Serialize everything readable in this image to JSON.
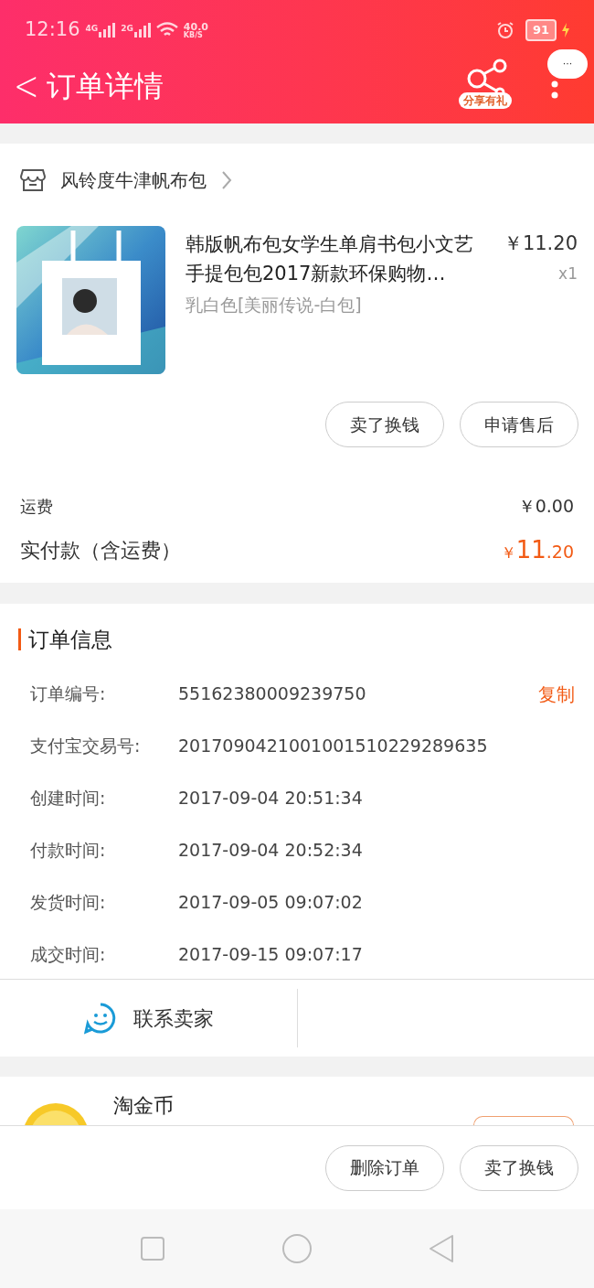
{
  "status_bar": {
    "time": "12:16",
    "net_1": "4G",
    "net_2": "2G",
    "speed": "40.0",
    "speed_unit": "KB/S",
    "battery": "91"
  },
  "header": {
    "back": "<",
    "title": "订单详情",
    "share_badge": "分享有礼",
    "more_bubble": "···"
  },
  "shop": {
    "name": "风铃度牛津帆布包"
  },
  "product": {
    "kind": "picture",
    "title": "韩版帆布包女学生单肩书包小文艺手提包包2017新款环保购物…",
    "price": "￥11.20",
    "quantity": "x1",
    "variant": "乳白色[美丽传说-白包]"
  },
  "product_actions": [
    "卖了换钱",
    "申请售后"
  ],
  "costs": [
    {
      "label": "运费",
      "value": "￥0.00",
      "kind": "plain"
    },
    {
      "label": "实付款（含运费）",
      "currency": "￥",
      "value": "11",
      "decimals": ".20",
      "kind": "total"
    }
  ],
  "order_info": {
    "title": "订单信息",
    "copy": "复制",
    "rows": [
      {
        "label": "订单编号:",
        "value": "55162380009239750"
      },
      {
        "label": "支付宝交易号:",
        "value": "2017090421001001510229289635"
      },
      {
        "label": "创建时间:",
        "value": "2017-09-04 20:51:34"
      },
      {
        "label": "付款时间:",
        "value": "2017-09-04 20:52:34"
      },
      {
        "label": "发货时间:",
        "value": "2017-09-05 09:07:02"
      },
      {
        "label": "成交时间:",
        "value": "2017-09-15 09:07:17"
      }
    ]
  },
  "contact": {
    "label": "联系卖家"
  },
  "coins": {
    "title": "淘金币"
  },
  "bottom_actions": [
    "删除订单",
    "卖了换钱"
  ]
}
